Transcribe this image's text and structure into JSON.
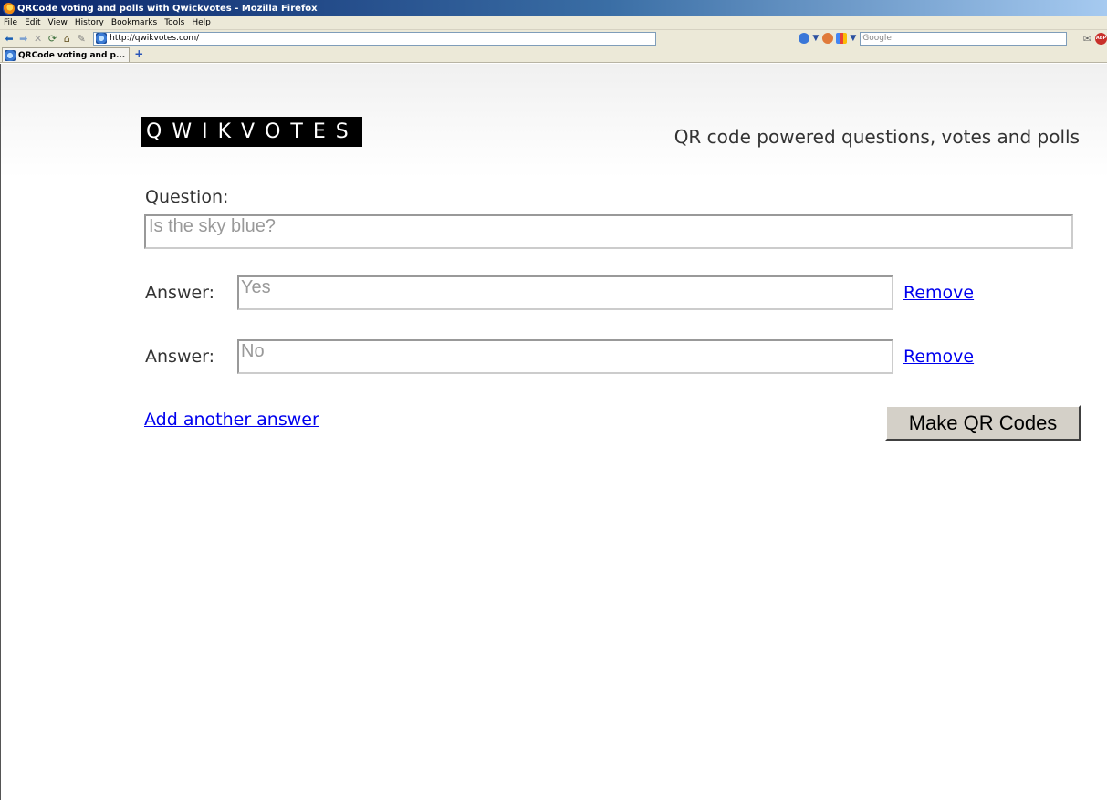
{
  "window": {
    "title": "QRCode voting and polls with Qwickvotes - Mozilla Firefox"
  },
  "menubar": {
    "items": [
      "File",
      "Edit",
      "View",
      "History",
      "Bookmarks",
      "Tools",
      "Help"
    ]
  },
  "navbar": {
    "url": "http://qwikvotes.com/",
    "search_placeholder": "Google"
  },
  "tabs": [
    {
      "label": "QRCode voting and p..."
    }
  ],
  "newtab_glyph": "+",
  "page": {
    "logo_text": [
      "Q",
      "W",
      "I",
      "K",
      "V",
      "O",
      "T",
      "E",
      "S"
    ],
    "tagline": "QR code powered questions, votes and polls",
    "question_label": "Question:",
    "question_value": "Is the sky blue?",
    "answers": [
      {
        "label": "Answer:",
        "value": "Yes",
        "remove": "Remove"
      },
      {
        "label": "Answer:",
        "value": "No",
        "remove": "Remove"
      }
    ],
    "add_answer": "Add another answer",
    "make_button": "Make QR Codes"
  },
  "colors": {
    "logo_bg": "#000000",
    "logo_accent": "#f2a81d",
    "link": "#0000ee"
  },
  "icons": [
    "firefox-icon",
    "back-icon",
    "forward-icon",
    "stop-icon",
    "reload-icon",
    "home-icon",
    "site-icon",
    "adblock-icon",
    "mail-icon"
  ]
}
